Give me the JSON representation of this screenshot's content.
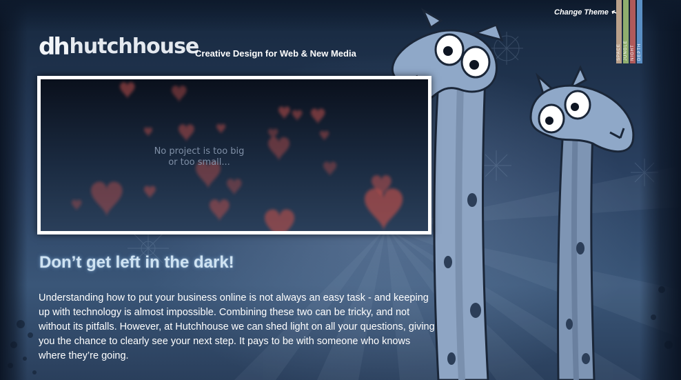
{
  "header": {
    "logo_mark": "dh",
    "logo_word": "hutchhouse",
    "tagline": "Creative Design for Web & New Media"
  },
  "theme_switcher": {
    "label": "Change Theme",
    "icon": "curved-arrow-icon",
    "themes": [
      {
        "name": "SPACE",
        "color": "#b9a08a"
      },
      {
        "name": "JUNGLE",
        "color": "#8fae6e"
      },
      {
        "name": "NIGHT",
        "color": "#b05a5a"
      },
      {
        "name": "DEPTH",
        "color": "#5a8fc4"
      }
    ]
  },
  "banner": {
    "line1": "No project is too big",
    "line2": "or too small..."
  },
  "content": {
    "headline": "Don’t get left in the dark!",
    "body": "Understanding how to put your business online is not always an easy task - and keeping up with technology is almost impossible. Combining these two can be tricky, and not without its pitfalls. However, at Hutchhouse we can shed light on all your questions, giving you the chance to clearly see your next step. It pays to be with someone who knows where they’re going."
  },
  "colors": {
    "background": "#2a4060",
    "heart": "#c0504a",
    "headline": "#cfe3f2",
    "giraffe": "#8fa8c8"
  }
}
